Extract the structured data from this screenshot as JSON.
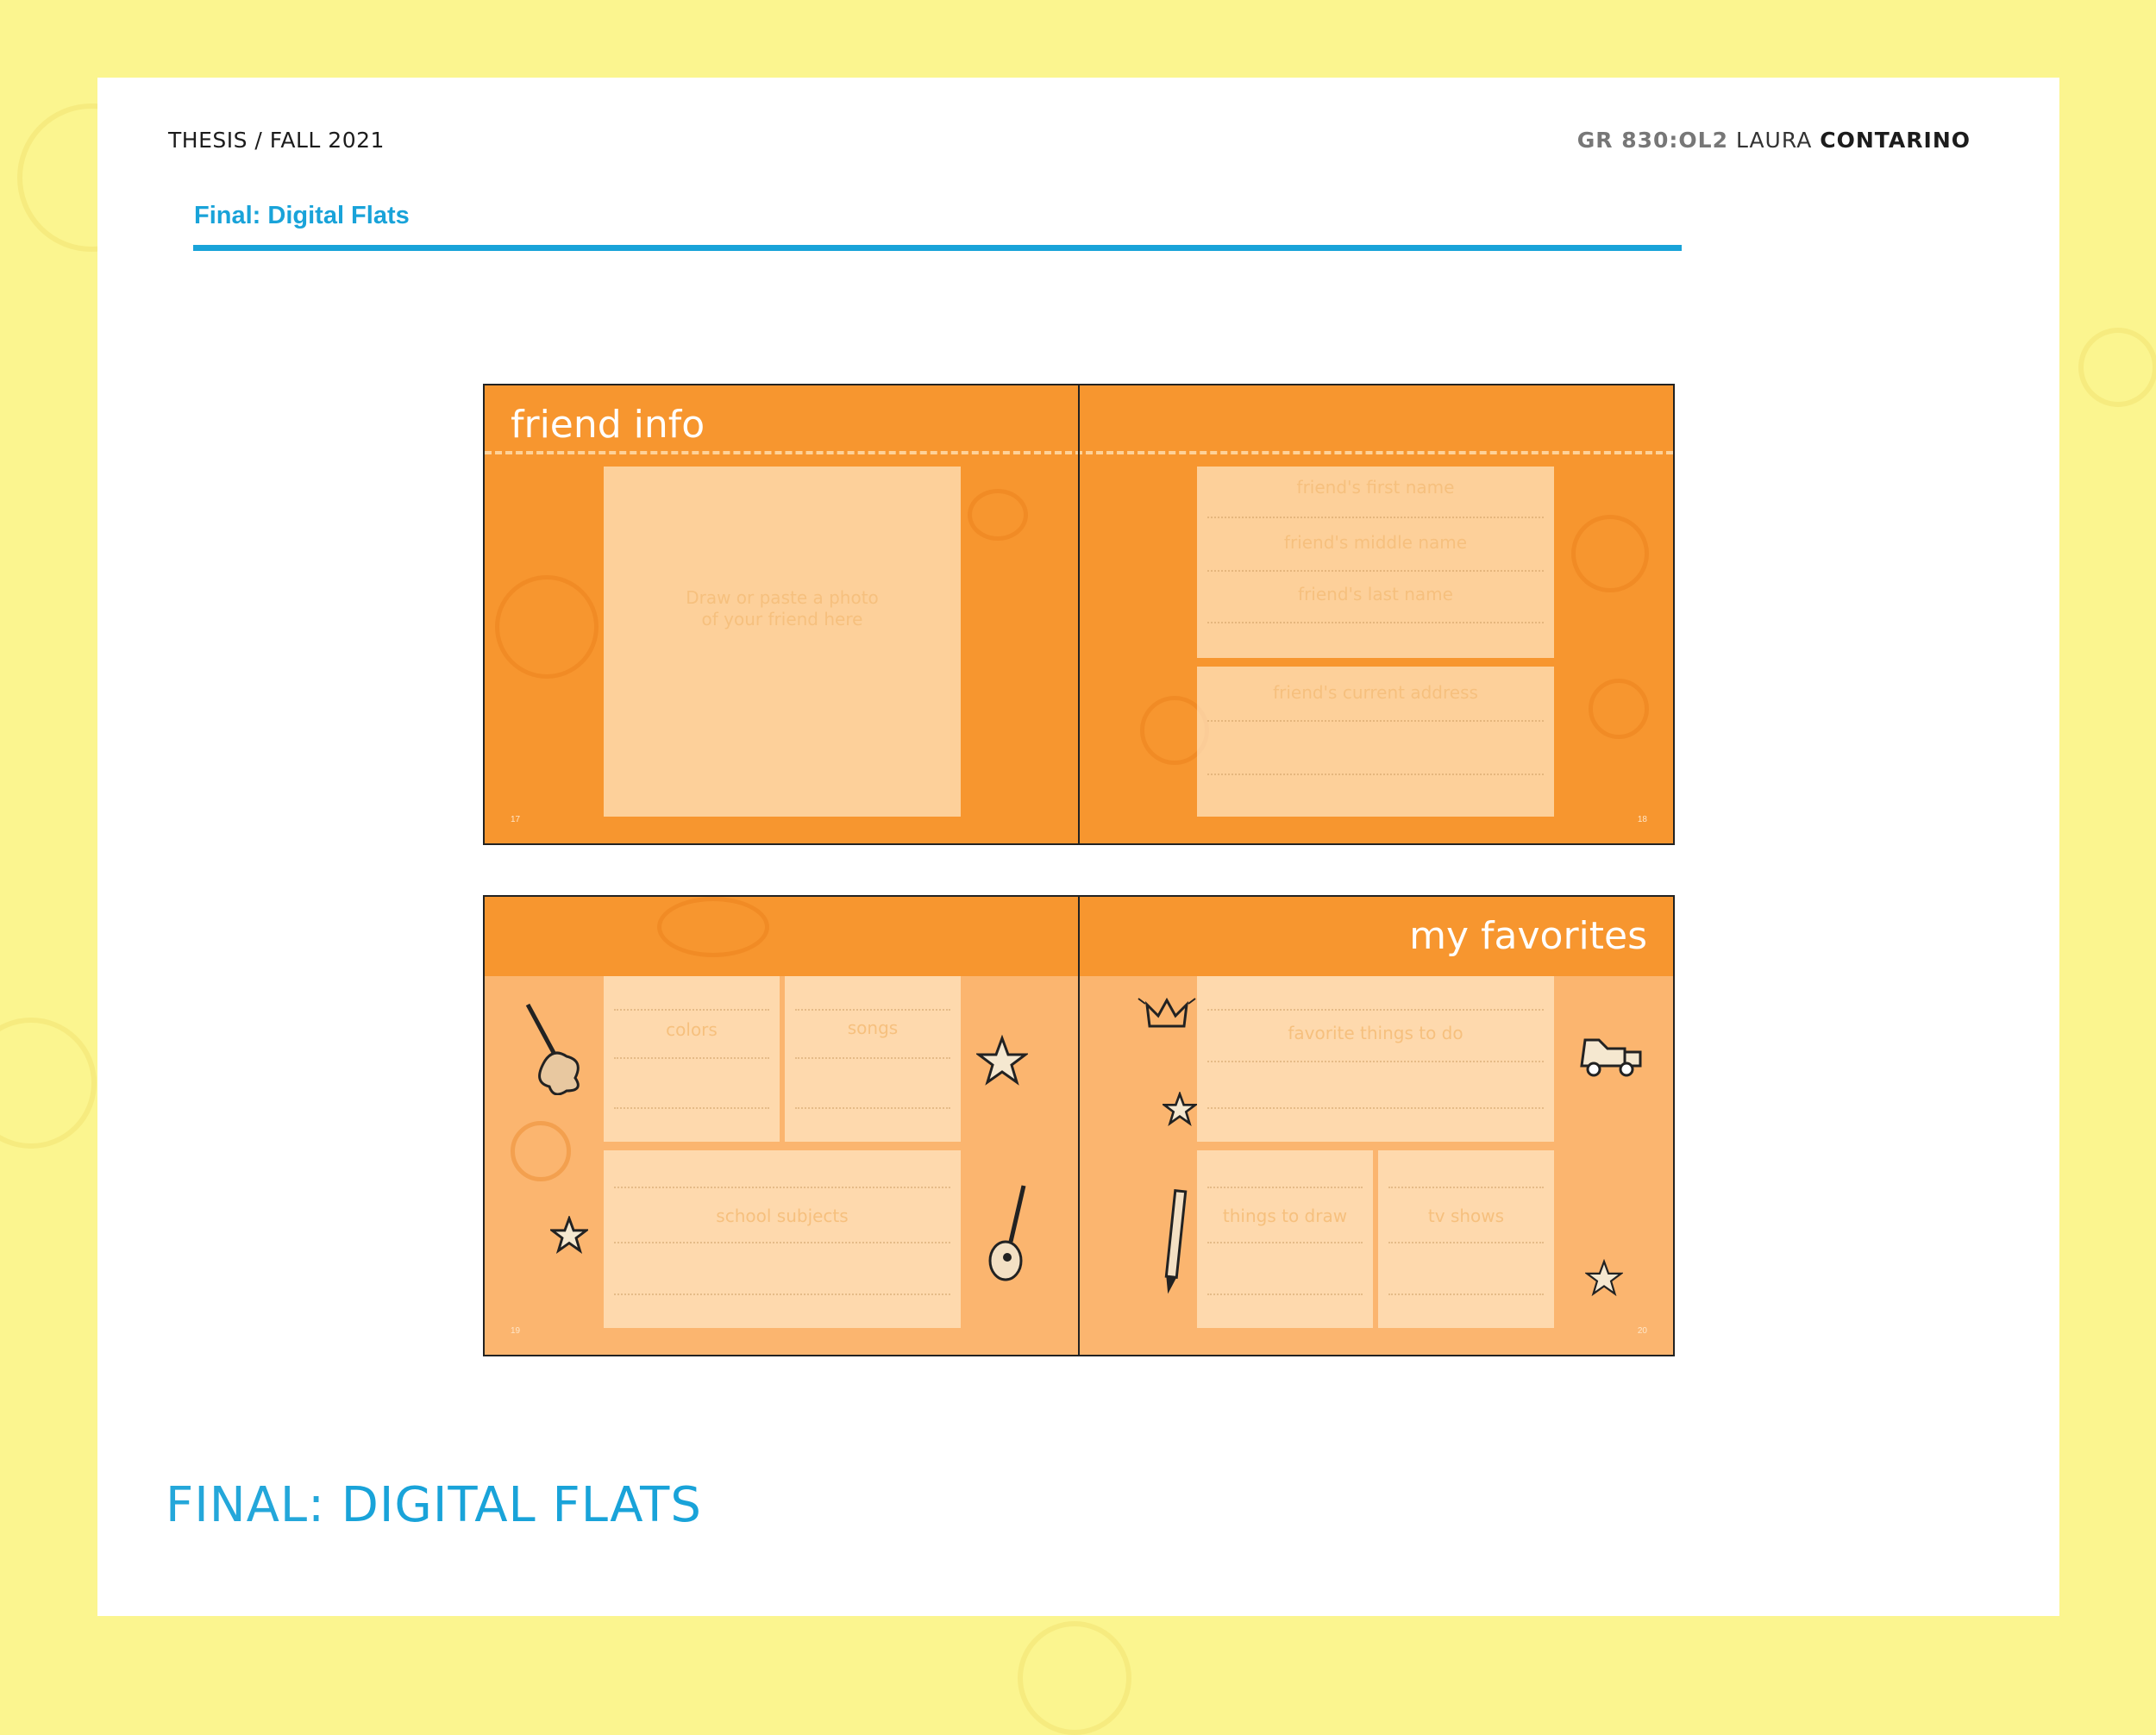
{
  "header": {
    "left": "THESIS / FALL 2021",
    "course_code": "GR 830:OL2",
    "first_name": "LAURA",
    "last_name": "CONTARINO"
  },
  "section": {
    "title": "Final: Digital Flats"
  },
  "footer": {
    "title_light": "FINAL: ",
    "title_strong": "DIGITAL FLATS"
  },
  "spread1": {
    "left_title": "friend info",
    "photo_prompt_line1": "Draw or paste a photo",
    "photo_prompt_line2": "of your friend here",
    "first_name": "friend's first name",
    "middle_name": "friend's middle name",
    "last_name": "friend's last name",
    "address": "friend's current address",
    "page_left": "17",
    "page_right": "18"
  },
  "spread2": {
    "right_title": "my favorites",
    "colors": "colors",
    "songs": "songs",
    "school_subjects": "school subjects",
    "favorite_things": "favorite things to do",
    "things_to_draw": "things to draw",
    "tv_shows": "tv shows",
    "page_left": "19",
    "page_right": "20"
  },
  "colors": {
    "accent": "#19a3d9",
    "orange": "#f7962f",
    "yellow_bg": "#fbf58f"
  }
}
